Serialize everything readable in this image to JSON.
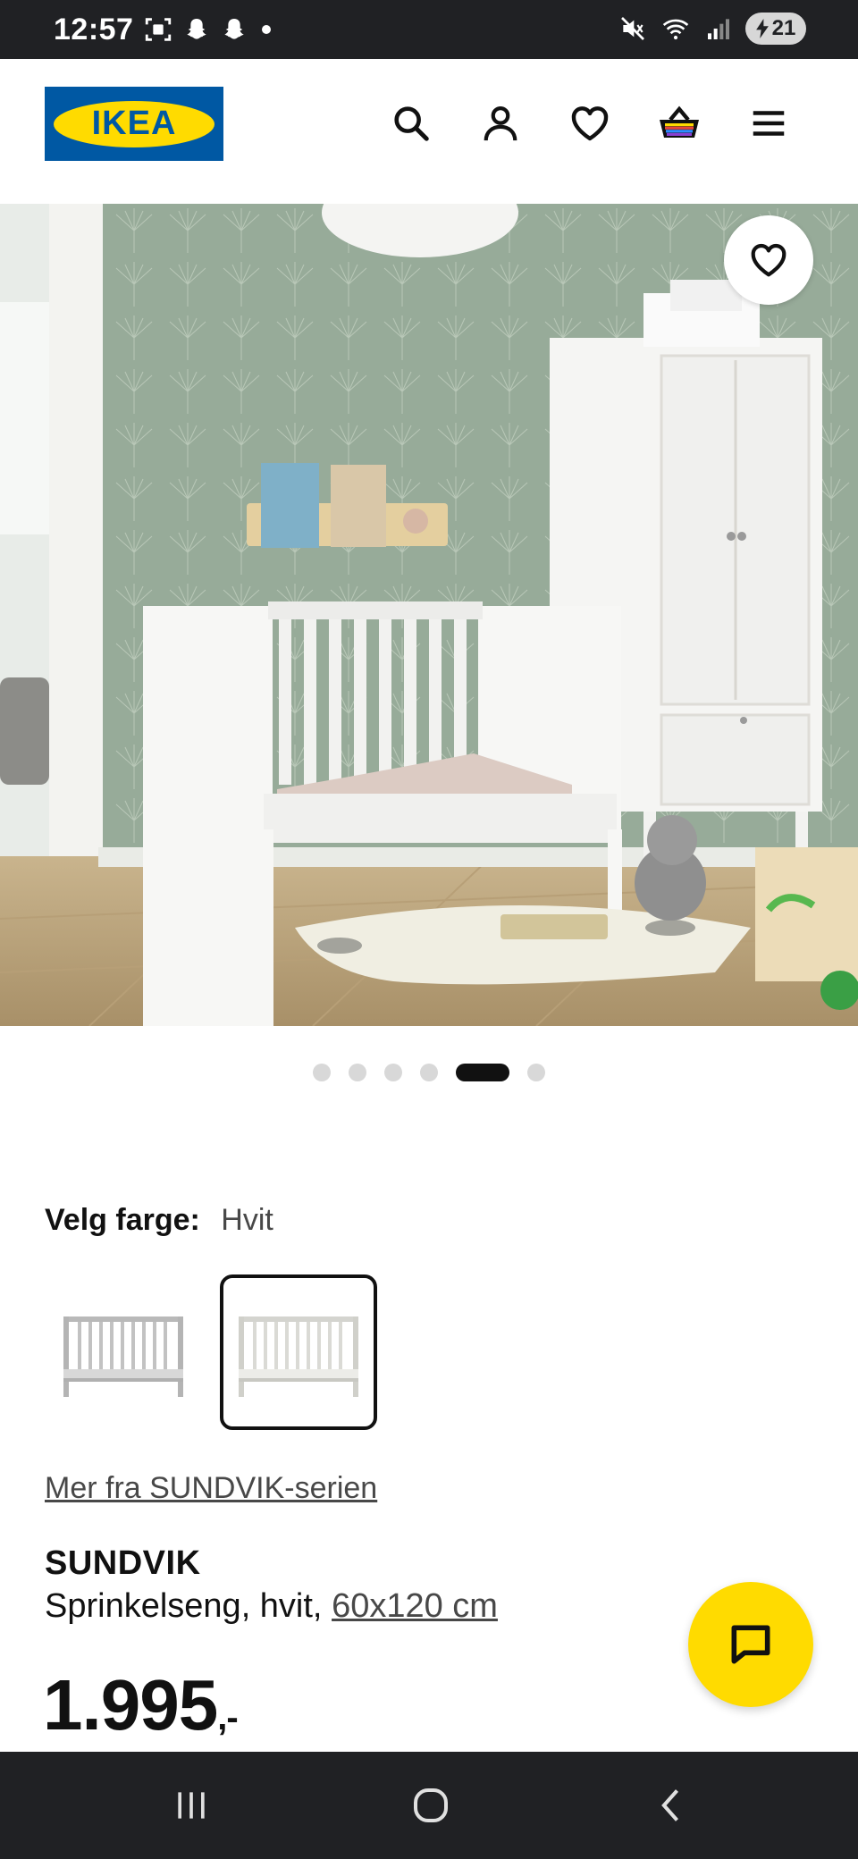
{
  "status_bar": {
    "time": "12:57",
    "battery": "21"
  },
  "header": {
    "logo_text": "IKEA",
    "icons": [
      "search-icon",
      "account-icon",
      "heart-icon",
      "basket-icon",
      "menu-icon"
    ]
  },
  "carousel": {
    "dot_count": 6,
    "active_index": 4
  },
  "color_select": {
    "label": "Velg farge:",
    "value": "Hvit"
  },
  "series_link": "Mer fra SUNDVIK-serien",
  "product": {
    "name": "SUNDVIK",
    "desc_prefix": "Sprinkelseng, hvit, ",
    "size": "60x120 cm",
    "price": "1.995",
    "price_suffix": ",-"
  },
  "colors": {
    "ikea_blue": "#0058A3",
    "ikea_yellow": "#FFDB00",
    "system_bar": "#202124"
  }
}
